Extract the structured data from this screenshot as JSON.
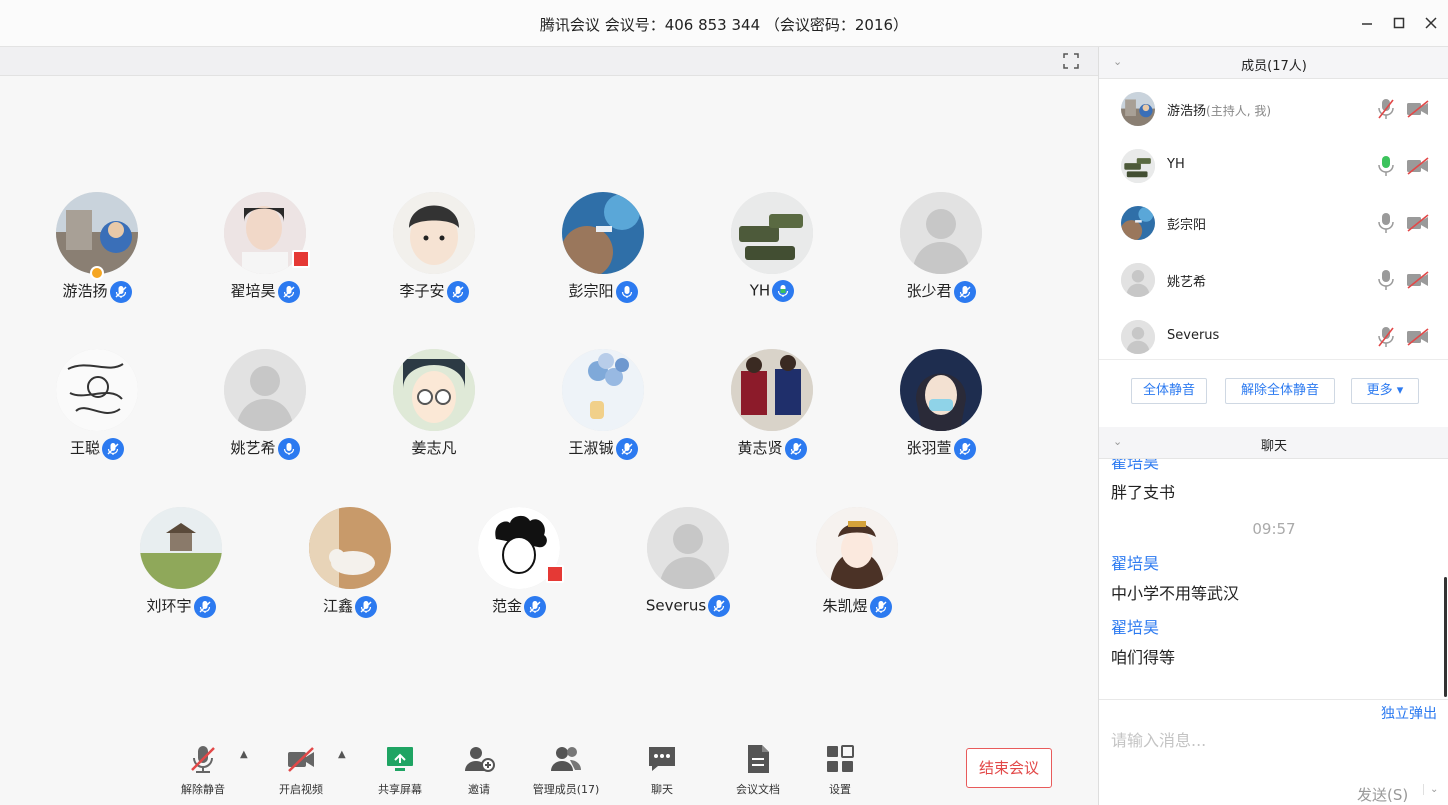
{
  "window": {
    "title": "腾讯会议 会议号：406 853 344 （会议密码：2016）"
  },
  "participants": [
    {
      "name": "游浩扬",
      "avatar": "photo-building",
      "mic": "muted"
    },
    {
      "name": "翟培昊",
      "avatar": "photo-portrait",
      "mic": "muted"
    },
    {
      "name": "李子安",
      "avatar": "cartoon-boy",
      "mic": "muted"
    },
    {
      "name": "彭宗阳",
      "avatar": "photo-ocean",
      "mic": "unmuted"
    },
    {
      "name": "YH",
      "avatar": "photo-tanks",
      "mic": "speaking"
    },
    {
      "name": "张少君",
      "avatar": "default",
      "mic": "muted"
    },
    {
      "name": "王聪",
      "avatar": "sketch",
      "mic": "muted"
    },
    {
      "name": "姚艺希",
      "avatar": "default",
      "mic": "unmuted"
    },
    {
      "name": "姜志凡",
      "avatar": "anime-detective",
      "mic": "none"
    },
    {
      "name": "王淑铖",
      "avatar": "balloons",
      "mic": "muted"
    },
    {
      "name": "黄志贤",
      "avatar": "photo-football",
      "mic": "muted"
    },
    {
      "name": "张羽萱",
      "avatar": "anime-mask",
      "mic": "muted"
    },
    {
      "name": "刘环宇",
      "avatar": "photo-landscape",
      "mic": "muted"
    },
    {
      "name": "江鑫",
      "avatar": "photo-cat",
      "mic": "muted"
    },
    {
      "name": "范金",
      "avatar": "sketch-boy",
      "mic": "muted"
    },
    {
      "name": "Severus",
      "avatar": "default",
      "mic": "muted"
    },
    {
      "name": "朱凯煜",
      "avatar": "anime-girl",
      "mic": "muted"
    }
  ],
  "members_panel": {
    "header": "成员(17人)",
    "members": [
      {
        "name": "游浩扬",
        "role": "(主持人, 我)",
        "mic": "muted",
        "camera": "off"
      },
      {
        "name": "YH",
        "role": "",
        "mic": "speaking",
        "camera": "off"
      },
      {
        "name": "彭宗阳",
        "role": "",
        "mic": "unmuted",
        "camera": "off"
      },
      {
        "name": "姚艺希",
        "role": "",
        "mic": "unmuted",
        "camera": "off"
      },
      {
        "name": "Severus",
        "role": "",
        "mic": "muted",
        "camera": "off"
      }
    ],
    "mute_all": "全体静音",
    "unmute_all": "解除全体静音",
    "more": "更多 ▾"
  },
  "chat": {
    "header": "聊天",
    "messages": [
      {
        "sender": "翟培昊",
        "text": "胖了支书"
      },
      {
        "time": "09:57"
      },
      {
        "sender": "翟培昊",
        "text": "中小学不用等武汉"
      },
      {
        "sender": "翟培昊",
        "text": "咱们得等"
      }
    ],
    "popout": "独立弹出",
    "placeholder": "请输入消息...",
    "send": "发送(S)"
  },
  "toolbar": {
    "unmute": "解除静音",
    "start_video": "开启视频",
    "share_screen": "共享屏幕",
    "invite": "邀请",
    "manage_members": "管理成员(17)",
    "chat": "聊天",
    "docs": "会议文档",
    "settings": "设置",
    "end_meeting": "结束会议"
  },
  "colors": {
    "accent": "#2c7af0",
    "end": "#e24848",
    "speaking": "#3cc35c",
    "share": "#1fa463"
  }
}
